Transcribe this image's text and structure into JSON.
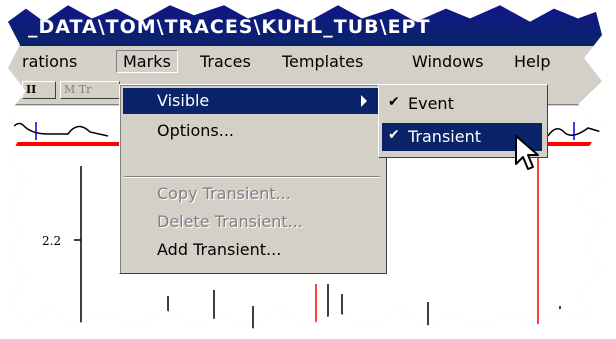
{
  "window": {
    "title": "_DATA\\TOM\\TRACES\\KUHL_TUB\\EPT"
  },
  "menubar": {
    "items": [
      {
        "label": "rations"
      },
      {
        "label": "Marks"
      },
      {
        "label": "Traces"
      },
      {
        "label": "Templates"
      },
      {
        "label": "Windows"
      },
      {
        "label": "Help"
      }
    ]
  },
  "toolbar": {
    "buttons": [
      {
        "label": "II"
      },
      {
        "label": "M Tr"
      }
    ]
  },
  "marks_menu": {
    "items": [
      {
        "label": "Visible",
        "state": "highlighted",
        "has_submenu": true
      },
      {
        "label": "Options...",
        "state": "enabled"
      },
      {
        "label": "Copy Transient...",
        "state": "disabled"
      },
      {
        "label": "Delete Transient...",
        "state": "disabled"
      },
      {
        "label": "Add Transient...",
        "state": "enabled"
      }
    ]
  },
  "visible_submenu": {
    "items": [
      {
        "label": "Event",
        "checked": true,
        "state": "enabled"
      },
      {
        "label": "Transient",
        "checked": true,
        "state": "highlighted"
      }
    ],
    "check_glyph": "✔"
  },
  "plot": {
    "y_tick_label": "2.2"
  },
  "colors": {
    "titlebar": "#0a246a",
    "highlight": "#0a246a",
    "chrome": "#d4d0c8",
    "marker_red": "#ff0000"
  },
  "icons": {
    "submenu_arrow": "chevron-right-icon",
    "check": "checkmark-icon",
    "cursor": "arrow-cursor-icon"
  }
}
